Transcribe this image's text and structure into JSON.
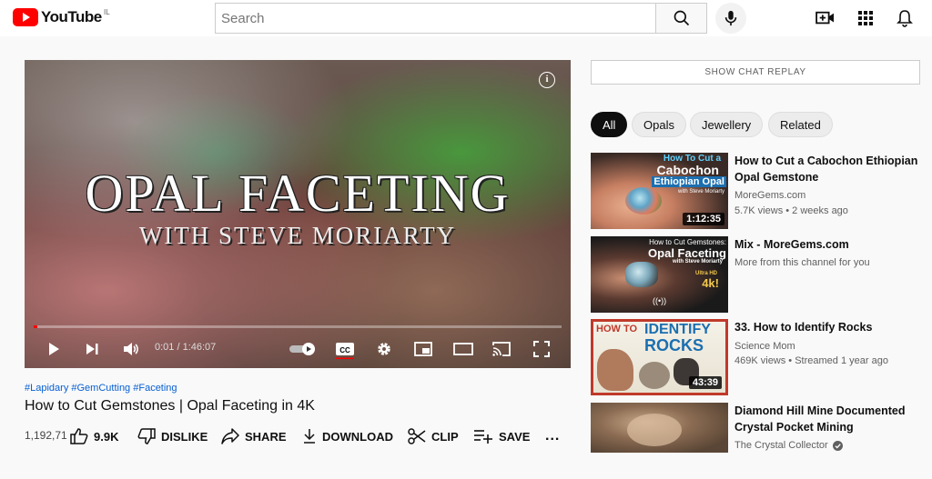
{
  "header": {
    "logo_text": "YouTube",
    "country_code": "IL",
    "search_placeholder": "Search"
  },
  "player": {
    "overlay_title": "OPAL FACETING",
    "overlay_subtitle": "WITH STEVE MORIARTY",
    "info_glyph": "i",
    "time": "0:01 / 1:46:07",
    "progress": 0.0001,
    "cc_label": "CC"
  },
  "video": {
    "tags": "#Lapidary #GemCutting #Faceting",
    "title": "How to Cut Gemstones | Opal Faceting in 4K",
    "views": "1,192,71",
    "like_count": "9.9K",
    "dislike_label": "DISLIKE",
    "share_label": "SHARE",
    "download_label": "DOWNLOAD",
    "clip_label": "CLIP",
    "save_label": "SAVE",
    "more_glyph": "..."
  },
  "sidebar": {
    "chat_button": "SHOW CHAT REPLAY",
    "chips": [
      {
        "label": "All",
        "active": true
      },
      {
        "label": "Opals",
        "active": false
      },
      {
        "label": "Jewellery",
        "active": false
      },
      {
        "label": "Related",
        "active": false
      }
    ],
    "recommendations": [
      {
        "title": "How to Cut a Cabochon Ethiopian Opal Gemstone",
        "channel": "MoreGems.com",
        "meta": "5.7K views • 2 weeks ago",
        "duration": "1:12:35",
        "thumb_lines": [
          "How To Cut a",
          "Cabochon",
          "Ethiopian Opal",
          "with Steve Moriarty"
        ]
      },
      {
        "title": "Mix - MoreGems.com",
        "channel": "More from this channel for you",
        "meta": "",
        "duration": "",
        "thumb_lines": [
          "How to Cut Gemstones:",
          "Opal Faceting",
          "with Steve Moriarty",
          "Ultra HD",
          "4k!",
          "((•))"
        ]
      },
      {
        "title": "33. How to Identify Rocks",
        "channel": "Science Mom",
        "meta": "469K views • Streamed 1 year ago",
        "duration": "43:39",
        "thumb_lines": [
          "HOW TO",
          "IDENTIFY",
          "ROCKS"
        ]
      },
      {
        "title": "Diamond Hill Mine Documented Crystal Pocket Mining",
        "channel": "The Crystal Collector",
        "meta": "",
        "duration": "",
        "thumb_lines": []
      }
    ]
  },
  "colors": {
    "brand_red": "#ff0000",
    "link_blue": "#065fd4",
    "progress_red": "#ff0000"
  }
}
